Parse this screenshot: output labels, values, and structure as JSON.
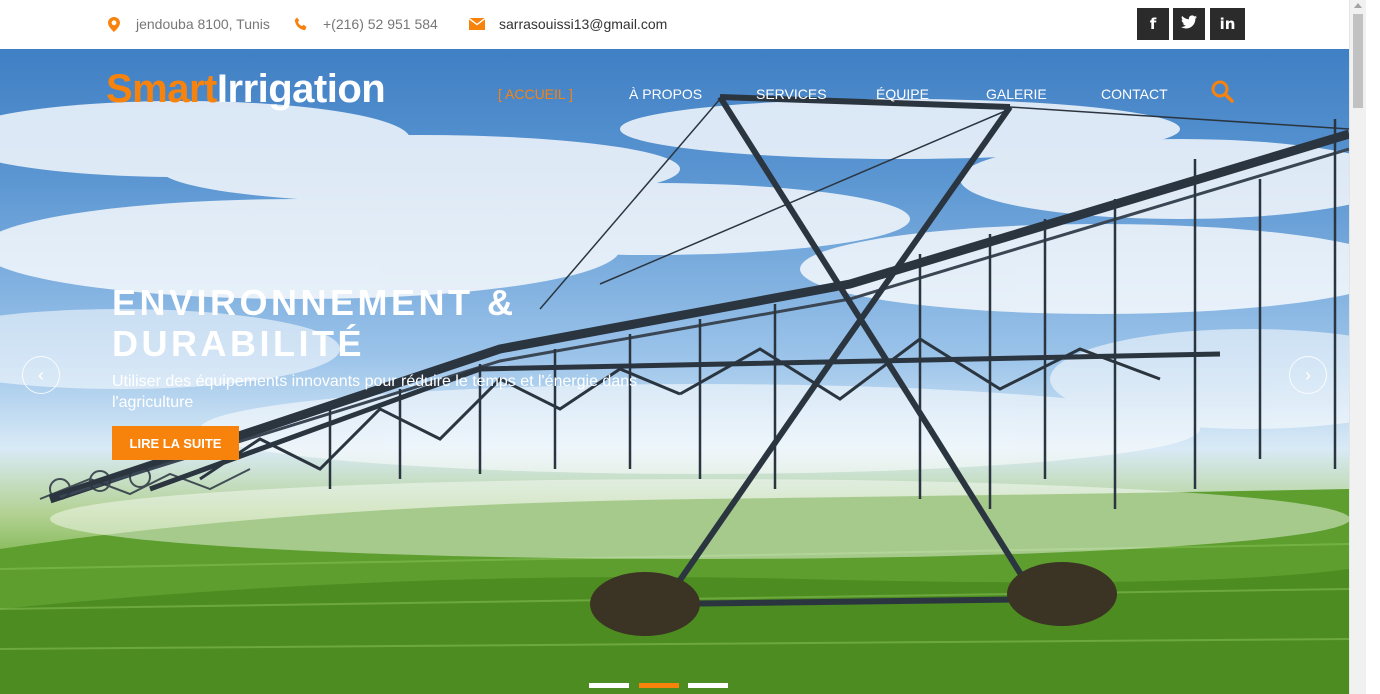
{
  "topbar": {
    "address": "jendouba 8100, Tunis",
    "phone": "+(216) 52 951 584",
    "email": "sarrasouissi13@gmail.com",
    "icons": {
      "address": "map-pin-icon",
      "phone": "phone-icon",
      "email": "envelope-icon"
    },
    "social": [
      {
        "label": "f",
        "icon": "facebook-icon"
      },
      {
        "label": "🐦",
        "icon": "twitter-icon"
      },
      {
        "label": "in",
        "icon": "linkedin-icon"
      }
    ]
  },
  "brand": {
    "part1": "Smart",
    "part2": "Irrigation"
  },
  "nav": {
    "items": [
      "[ ACCUEIL ]",
      "À PROPOS",
      "SERVICES",
      "ÉQUIPE",
      "GALERIE",
      "CONTACT"
    ],
    "active_index": 0,
    "search_icon": "search-icon"
  },
  "hero": {
    "title_line1": "ENVIRONNEMENT &",
    "title_line2": "DURABILITÉ",
    "subtitle": "Utiliser des équipements innovants pour réduire le temps et l'énergie dans l'agriculture",
    "cta_label": "LIRE LA SUITE",
    "prev_label": "‹",
    "next_label": "›",
    "slides_count": 3,
    "active_slide": 2
  },
  "colors": {
    "accent": "#f7830d",
    "dark": "#2b2b2b",
    "muted_text": "#777777"
  }
}
